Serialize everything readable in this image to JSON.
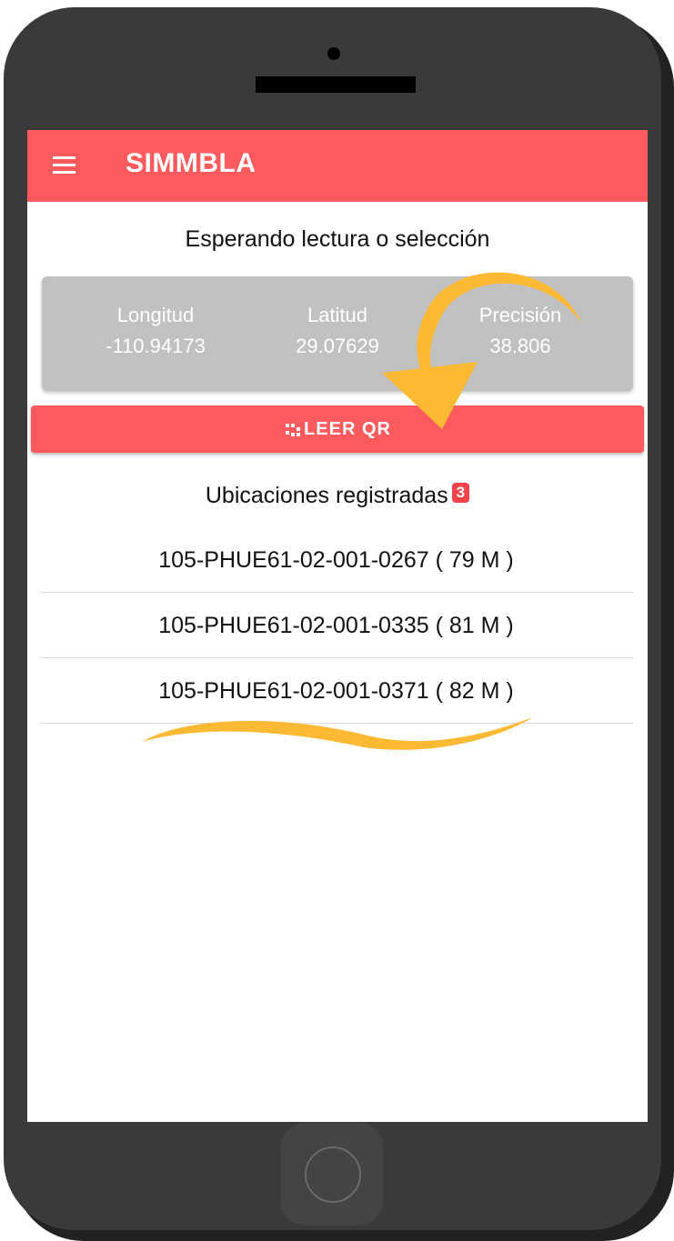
{
  "app": {
    "title": "SIMMBLA",
    "accent_color": "#fd5a5e",
    "menu_icon": "hamburger-menu-icon"
  },
  "status": {
    "text": "Esperando lectura o selección"
  },
  "coordinates": {
    "longitude_label": "Longitud",
    "longitude_value": "-110.94173",
    "latitude_label": "Latitud",
    "latitude_value": "29.07629",
    "precision_label": "Precisión",
    "precision_value": "38.806"
  },
  "qr_button": {
    "label": "LEER QR",
    "icon": "qr-code-icon"
  },
  "locations": {
    "title": "Ubicaciones registradas",
    "count": "3",
    "items": [
      {
        "label": "105-PHUE61-02-001-0267 ( 79 M )"
      },
      {
        "label": "105-PHUE61-02-001-0335 ( 81 M )"
      },
      {
        "label": "105-PHUE61-02-001-0371 ( 82 M )"
      }
    ]
  },
  "annotations": {
    "color": "#fbb934",
    "arrow_icon": "curved-arrow-icon",
    "underline": "highlight-underline"
  }
}
